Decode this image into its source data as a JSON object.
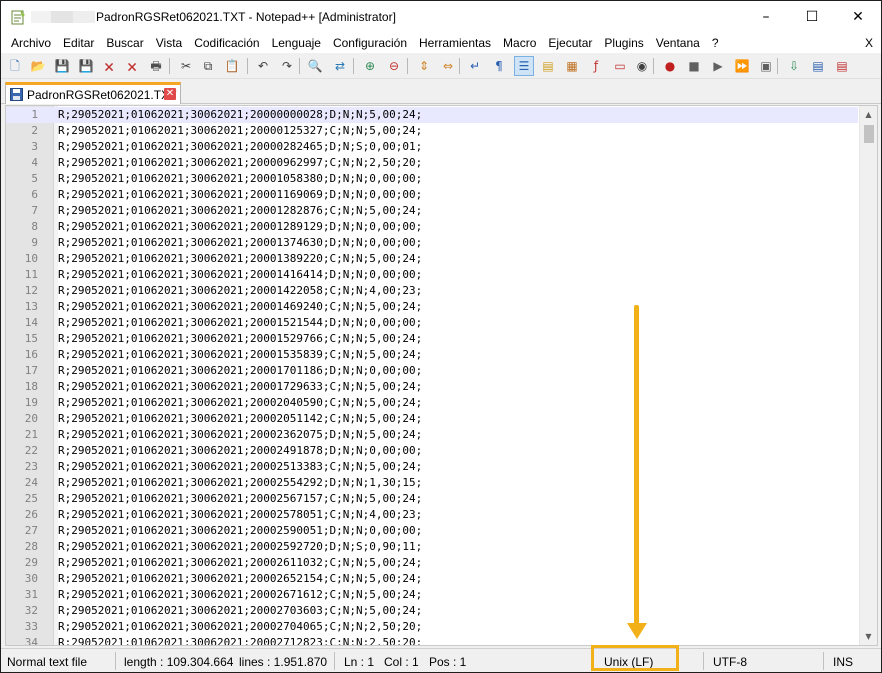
{
  "window": {
    "title": "PadronRGSRet062021.TXT - Notepad++ [Administrator]",
    "controls": {
      "minimize": "–",
      "maximize": "☐",
      "close": "✕"
    }
  },
  "menu": {
    "items": [
      "Archivo",
      "Editar",
      "Buscar",
      "Vista",
      "Codificación",
      "Lenguaje",
      "Configuración",
      "Herramientas",
      "Macro",
      "Ejecutar",
      "Plugins",
      "Ventana",
      "?"
    ],
    "close_label": "X"
  },
  "toolbar": {
    "buttons": [
      {
        "name": "new-file-icon",
        "glyph": "🗋",
        "color": "#3a6fb0"
      },
      {
        "name": "open-file-icon",
        "glyph": "📂",
        "color": "#d9a520"
      },
      {
        "name": "save-icon",
        "glyph": "💾",
        "color": "#3b5ea8"
      },
      {
        "name": "save-all-icon",
        "glyph": "💾",
        "color": "#3b5ea8"
      },
      {
        "name": "close-file-icon",
        "glyph": "🗙",
        "color": "#c03030"
      },
      {
        "name": "close-all-icon",
        "glyph": "🗙",
        "color": "#c03030"
      },
      {
        "name": "print-icon",
        "glyph": "🖶",
        "color": "#505050"
      },
      {
        "name": "cut-icon",
        "glyph": "✂",
        "color": "#404040"
      },
      {
        "name": "copy-icon",
        "glyph": "⧉",
        "color": "#404040"
      },
      {
        "name": "paste-icon",
        "glyph": "📋",
        "color": "#8a6a30"
      },
      {
        "name": "undo-icon",
        "glyph": "↶",
        "color": "#404040"
      },
      {
        "name": "redo-icon",
        "glyph": "↷",
        "color": "#404040"
      },
      {
        "name": "find-icon",
        "glyph": "🔍",
        "color": "#404040"
      },
      {
        "name": "replace-icon",
        "glyph": "⇄",
        "color": "#2a7ab8"
      },
      {
        "name": "zoom-in-icon",
        "glyph": "⊕",
        "color": "#2e8b57"
      },
      {
        "name": "zoom-out-icon",
        "glyph": "⊖",
        "color": "#c03030"
      },
      {
        "name": "sync-vertical-icon",
        "glyph": "⇕",
        "color": "#d08020"
      },
      {
        "name": "sync-horizontal-icon",
        "glyph": "⇔",
        "color": "#d08020"
      },
      {
        "name": "word-wrap-icon",
        "glyph": "↵",
        "color": "#2a60b0"
      },
      {
        "name": "show-all-chars-icon",
        "glyph": "¶",
        "color": "#2a60b0"
      },
      {
        "name": "indent-guide-icon",
        "glyph": "☰",
        "color": "#2a60b0"
      },
      {
        "name": "udl-icon",
        "glyph": "▤",
        "color": "#d0a020"
      },
      {
        "name": "doc-map-icon",
        "glyph": "▦",
        "color": "#c07020"
      },
      {
        "name": "function-list-icon",
        "glyph": "ƒ",
        "color": "#c03030"
      },
      {
        "name": "folder-workspace-icon",
        "glyph": "▭",
        "color": "#c03030"
      },
      {
        "name": "monitoring-icon",
        "glyph": "◉",
        "color": "#404040"
      },
      {
        "name": "record-macro-icon",
        "glyph": "●",
        "color": "#c02020"
      },
      {
        "name": "stop-record-icon",
        "glyph": "■",
        "color": "#606060"
      },
      {
        "name": "play-macro-icon",
        "glyph": "▶",
        "color": "#606060"
      },
      {
        "name": "run-macro-multiple-icon",
        "glyph": "⏩",
        "color": "#2a60b0"
      },
      {
        "name": "save-macro-icon",
        "glyph": "▣",
        "color": "#606060"
      },
      {
        "name": "plugin-one-icon",
        "glyph": "⇩",
        "color": "#2e8b57"
      },
      {
        "name": "plugin-two-icon",
        "glyph": "▤",
        "color": "#2a60b0"
      },
      {
        "name": "plugin-three-icon",
        "glyph": "▤",
        "color": "#c03030"
      }
    ]
  },
  "tab": {
    "label": "PadronRGSRet062021.TXT",
    "close": "✕"
  },
  "editor": {
    "lines": [
      {
        "n": "1",
        "text": "R;29052021;01062021;30062021;20000000028;D;N;N;5,00;24;"
      },
      {
        "n": "2",
        "text": "R;29052021;01062021;30062021;20000125327;C;N;N;5,00;24;"
      },
      {
        "n": "3",
        "text": "R;29052021;01062021;30062021;20000282465;D;N;S;0,00;01;"
      },
      {
        "n": "4",
        "text": "R;29052021;01062021;30062021;20000962997;C;N;N;2,50;20;"
      },
      {
        "n": "5",
        "text": "R;29052021;01062021;30062021;20001058380;D;N;N;0,00;00;"
      },
      {
        "n": "6",
        "text": "R;29052021;01062021;30062021;20001169069;D;N;N;0,00;00;"
      },
      {
        "n": "7",
        "text": "R;29052021;01062021;30062021;20001282876;C;N;N;5,00;24;"
      },
      {
        "n": "8",
        "text": "R;29052021;01062021;30062021;20001289129;D;N;N;0,00;00;"
      },
      {
        "n": "9",
        "text": "R;29052021;01062021;30062021;20001374630;D;N;N;0,00;00;"
      },
      {
        "n": "10",
        "text": "R;29052021;01062021;30062021;20001389220;C;N;N;5,00;24;"
      },
      {
        "n": "11",
        "text": "R;29052021;01062021;30062021;20001416414;D;N;N;0,00;00;"
      },
      {
        "n": "12",
        "text": "R;29052021;01062021;30062021;20001422058;C;N;N;4,00;23;"
      },
      {
        "n": "13",
        "text": "R;29052021;01062021;30062021;20001469240;C;N;N;5,00;24;"
      },
      {
        "n": "14",
        "text": "R;29052021;01062021;30062021;20001521544;D;N;N;0,00;00;"
      },
      {
        "n": "15",
        "text": "R;29052021;01062021;30062021;20001529766;C;N;N;5,00;24;"
      },
      {
        "n": "16",
        "text": "R;29052021;01062021;30062021;20001535839;C;N;N;5,00;24;"
      },
      {
        "n": "17",
        "text": "R;29052021;01062021;30062021;20001701186;D;N;N;0,00;00;"
      },
      {
        "n": "18",
        "text": "R;29052021;01062021;30062021;20001729633;C;N;N;5,00;24;"
      },
      {
        "n": "19",
        "text": "R;29052021;01062021;30062021;20002040590;C;N;N;5,00;24;"
      },
      {
        "n": "20",
        "text": "R;29052021;01062021;30062021;20002051142;C;N;N;5,00;24;"
      },
      {
        "n": "21",
        "text": "R;29052021;01062021;30062021;20002362075;D;N;N;5,00;24;"
      },
      {
        "n": "22",
        "text": "R;29052021;01062021;30062021;20002491878;D;N;N;0,00;00;"
      },
      {
        "n": "23",
        "text": "R;29052021;01062021;30062021;20002513383;C;N;N;5,00;24;"
      },
      {
        "n": "24",
        "text": "R;29052021;01062021;30062021;20002554292;D;N;N;1,30;15;"
      },
      {
        "n": "25",
        "text": "R;29052021;01062021;30062021;20002567157;C;N;N;5,00;24;"
      },
      {
        "n": "26",
        "text": "R;29052021;01062021;30062021;20002578051;C;N;N;4,00;23;"
      },
      {
        "n": "27",
        "text": "R;29052021;01062021;30062021;20002590051;D;N;N;0,00;00;"
      },
      {
        "n": "28",
        "text": "R;29052021;01062021;30062021;20002592720;D;N;S;0,90;11;"
      },
      {
        "n": "29",
        "text": "R;29052021;01062021;30062021;20002611032;C;N;N;5,00;24;"
      },
      {
        "n": "30",
        "text": "R;29052021;01062021;30062021;20002652154;C;N;N;5,00;24;"
      },
      {
        "n": "31",
        "text": "R;29052021;01062021;30062021;20002671612;C;N;N;5,00;24;"
      },
      {
        "n": "32",
        "text": "R;29052021;01062021;30062021;20002703603;C;N;N;5,00;24;"
      },
      {
        "n": "33",
        "text": "R;29052021;01062021;30062021;20002704065;C;N;N;2,50;20;"
      },
      {
        "n": "34",
        "text": "R;29052021;01062021;30062021;20002712823;C;N;N;2,50;20;"
      }
    ]
  },
  "status": {
    "file_type": "Normal text file",
    "length": "length : 109.304.664",
    "lines": "lines : 1.951.870",
    "ln": "Ln : 1",
    "col": "Col : 1",
    "pos": "Pos : 1",
    "eol": "Unix (LF)",
    "encoding": "UTF-8",
    "mode": "INS"
  },
  "colors": {
    "annotation": "#f3b119",
    "tab_accent": "#f5a623",
    "current_line": "#e8e8ff"
  }
}
